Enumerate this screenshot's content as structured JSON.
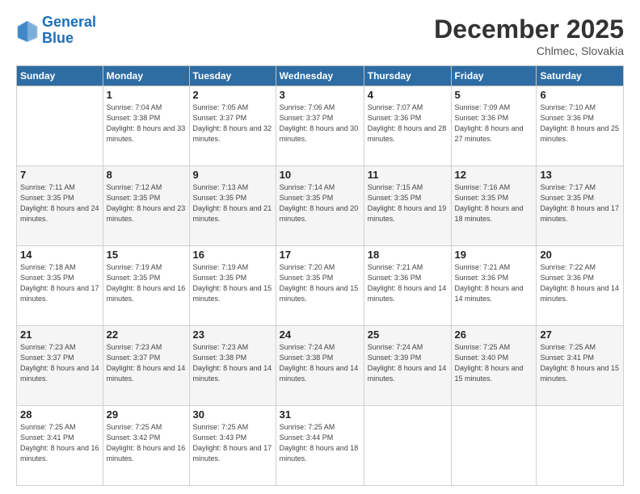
{
  "header": {
    "logo_line1": "General",
    "logo_line2": "Blue",
    "month_year": "December 2025",
    "location": "Chlmec, Slovakia"
  },
  "weekdays": [
    "Sunday",
    "Monday",
    "Tuesday",
    "Wednesday",
    "Thursday",
    "Friday",
    "Saturday"
  ],
  "weeks": [
    [
      {
        "day": "",
        "sunrise": "",
        "sunset": "",
        "daylight": "",
        "empty": true
      },
      {
        "day": "1",
        "sunrise": "Sunrise: 7:04 AM",
        "sunset": "Sunset: 3:38 PM",
        "daylight": "Daylight: 8 hours and 33 minutes."
      },
      {
        "day": "2",
        "sunrise": "Sunrise: 7:05 AM",
        "sunset": "Sunset: 3:37 PM",
        "daylight": "Daylight: 8 hours and 32 minutes."
      },
      {
        "day": "3",
        "sunrise": "Sunrise: 7:06 AM",
        "sunset": "Sunset: 3:37 PM",
        "daylight": "Daylight: 8 hours and 30 minutes."
      },
      {
        "day": "4",
        "sunrise": "Sunrise: 7:07 AM",
        "sunset": "Sunset: 3:36 PM",
        "daylight": "Daylight: 8 hours and 28 minutes."
      },
      {
        "day": "5",
        "sunrise": "Sunrise: 7:09 AM",
        "sunset": "Sunset: 3:36 PM",
        "daylight": "Daylight: 8 hours and 27 minutes."
      },
      {
        "day": "6",
        "sunrise": "Sunrise: 7:10 AM",
        "sunset": "Sunset: 3:36 PM",
        "daylight": "Daylight: 8 hours and 25 minutes."
      }
    ],
    [
      {
        "day": "7",
        "sunrise": "Sunrise: 7:11 AM",
        "sunset": "Sunset: 3:35 PM",
        "daylight": "Daylight: 8 hours and 24 minutes."
      },
      {
        "day": "8",
        "sunrise": "Sunrise: 7:12 AM",
        "sunset": "Sunset: 3:35 PM",
        "daylight": "Daylight: 8 hours and 23 minutes."
      },
      {
        "day": "9",
        "sunrise": "Sunrise: 7:13 AM",
        "sunset": "Sunset: 3:35 PM",
        "daylight": "Daylight: 8 hours and 21 minutes."
      },
      {
        "day": "10",
        "sunrise": "Sunrise: 7:14 AM",
        "sunset": "Sunset: 3:35 PM",
        "daylight": "Daylight: 8 hours and 20 minutes."
      },
      {
        "day": "11",
        "sunrise": "Sunrise: 7:15 AM",
        "sunset": "Sunset: 3:35 PM",
        "daylight": "Daylight: 8 hours and 19 minutes."
      },
      {
        "day": "12",
        "sunrise": "Sunrise: 7:16 AM",
        "sunset": "Sunset: 3:35 PM",
        "daylight": "Daylight: 8 hours and 18 minutes."
      },
      {
        "day": "13",
        "sunrise": "Sunrise: 7:17 AM",
        "sunset": "Sunset: 3:35 PM",
        "daylight": "Daylight: 8 hours and 17 minutes."
      }
    ],
    [
      {
        "day": "14",
        "sunrise": "Sunrise: 7:18 AM",
        "sunset": "Sunset: 3:35 PM",
        "daylight": "Daylight: 8 hours and 17 minutes."
      },
      {
        "day": "15",
        "sunrise": "Sunrise: 7:19 AM",
        "sunset": "Sunset: 3:35 PM",
        "daylight": "Daylight: 8 hours and 16 minutes."
      },
      {
        "day": "16",
        "sunrise": "Sunrise: 7:19 AM",
        "sunset": "Sunset: 3:35 PM",
        "daylight": "Daylight: 8 hours and 15 minutes."
      },
      {
        "day": "17",
        "sunrise": "Sunrise: 7:20 AM",
        "sunset": "Sunset: 3:35 PM",
        "daylight": "Daylight: 8 hours and 15 minutes."
      },
      {
        "day": "18",
        "sunrise": "Sunrise: 7:21 AM",
        "sunset": "Sunset: 3:36 PM",
        "daylight": "Daylight: 8 hours and 14 minutes."
      },
      {
        "day": "19",
        "sunrise": "Sunrise: 7:21 AM",
        "sunset": "Sunset: 3:36 PM",
        "daylight": "Daylight: 8 hours and 14 minutes."
      },
      {
        "day": "20",
        "sunrise": "Sunrise: 7:22 AM",
        "sunset": "Sunset: 3:36 PM",
        "daylight": "Daylight: 8 hours and 14 minutes."
      }
    ],
    [
      {
        "day": "21",
        "sunrise": "Sunrise: 7:23 AM",
        "sunset": "Sunset: 3:37 PM",
        "daylight": "Daylight: 8 hours and 14 minutes."
      },
      {
        "day": "22",
        "sunrise": "Sunrise: 7:23 AM",
        "sunset": "Sunset: 3:37 PM",
        "daylight": "Daylight: 8 hours and 14 minutes."
      },
      {
        "day": "23",
        "sunrise": "Sunrise: 7:23 AM",
        "sunset": "Sunset: 3:38 PM",
        "daylight": "Daylight: 8 hours and 14 minutes."
      },
      {
        "day": "24",
        "sunrise": "Sunrise: 7:24 AM",
        "sunset": "Sunset: 3:38 PM",
        "daylight": "Daylight: 8 hours and 14 minutes."
      },
      {
        "day": "25",
        "sunrise": "Sunrise: 7:24 AM",
        "sunset": "Sunset: 3:39 PM",
        "daylight": "Daylight: 8 hours and 14 minutes."
      },
      {
        "day": "26",
        "sunrise": "Sunrise: 7:25 AM",
        "sunset": "Sunset: 3:40 PM",
        "daylight": "Daylight: 8 hours and 15 minutes."
      },
      {
        "day": "27",
        "sunrise": "Sunrise: 7:25 AM",
        "sunset": "Sunset: 3:41 PM",
        "daylight": "Daylight: 8 hours and 15 minutes."
      }
    ],
    [
      {
        "day": "28",
        "sunrise": "Sunrise: 7:25 AM",
        "sunset": "Sunset: 3:41 PM",
        "daylight": "Daylight: 8 hours and 16 minutes."
      },
      {
        "day": "29",
        "sunrise": "Sunrise: 7:25 AM",
        "sunset": "Sunset: 3:42 PM",
        "daylight": "Daylight: 8 hours and 16 minutes."
      },
      {
        "day": "30",
        "sunrise": "Sunrise: 7:25 AM",
        "sunset": "Sunset: 3:43 PM",
        "daylight": "Daylight: 8 hours and 17 minutes."
      },
      {
        "day": "31",
        "sunrise": "Sunrise: 7:25 AM",
        "sunset": "Sunset: 3:44 PM",
        "daylight": "Daylight: 8 hours and 18 minutes."
      },
      {
        "day": "",
        "sunrise": "",
        "sunset": "",
        "daylight": "",
        "empty": true
      },
      {
        "day": "",
        "sunrise": "",
        "sunset": "",
        "daylight": "",
        "empty": true
      },
      {
        "day": "",
        "sunrise": "",
        "sunset": "",
        "daylight": "",
        "empty": true
      }
    ]
  ]
}
